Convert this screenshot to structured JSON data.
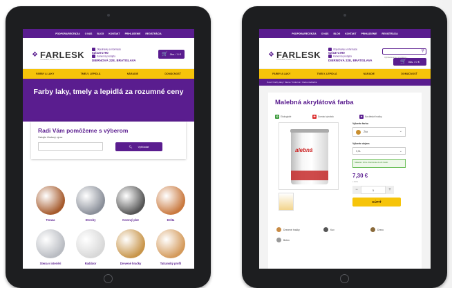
{
  "top_nav": [
    "PODPORA/RECENZIA",
    "O NÁS",
    "BLOG",
    "KONTAKT",
    "PRIHLÁSENIE",
    "REGISTRÁCIA"
  ],
  "logo": {
    "name": "FARLESK",
    "tagline": "STAVEBNÉ, FARBY, LAKY"
  },
  "contact": {
    "label": "Objednávky a informácie",
    "phone": "02/4371790",
    "address_label": "Kamenná predajňa",
    "address": "DIERNOVÁ 22E, BRATISLAVA"
  },
  "cart": {
    "label": "0ks. / 0 €"
  },
  "search": {
    "placeholder": "Vyhľadávanie produktov..."
  },
  "menu": [
    "FARBY A LAKY",
    "TMELY, LEPIDLÁ",
    "NÁRADIE",
    "DOMÁCNOSŤ"
  ],
  "hero_title": "Farby laky, tmely a lepidlá za rozumné ceny",
  "widget": {
    "title": "Radi Vám pomôžeme s výberom",
    "label": "Zadajte hľadaný výraz",
    "button": "Vyhľadať"
  },
  "categories": [
    {
      "name": "Terasa",
      "color": "#a55a2c"
    },
    {
      "name": "Strechy",
      "color": "#8a8f99"
    },
    {
      "name": "Kovový plot",
      "color": "#555555"
    },
    {
      "name": "Drôta",
      "color": "#c9793f"
    },
    {
      "name": "Stena v interiéri",
      "color": "#b9bcc2"
    },
    {
      "name": "Radiátor",
      "color": "#d8d8d8"
    },
    {
      "name": "Drevené hračky",
      "color": "#c8954a"
    },
    {
      "name": "Tatranský profil",
      "color": "#d49a5b"
    }
  ],
  "breadcrumb": "Úvod / Farby laky / Stena / Vnútorné / Vodou riediteľné",
  "product": {
    "title": "Malebná akrylátová farba",
    "features": [
      "Ekologické",
      "Domáci výrobok",
      "Na detské hračky"
    ],
    "brand_on_can": "alebná",
    "color_label": "Vyberte farbu",
    "color_value": "Žltá",
    "volume_label": "Vyberte objem",
    "volume_value": "0,5L",
    "stock": "Skladom 10 ks. Doručenie do 24 hodín.",
    "price": "7,30 €",
    "price_note": "s DPH",
    "qty": "1",
    "buy": "KÚPIŤ",
    "uses": [
      "Drevené hračky",
      "Kov",
      "Drevo",
      "Betón"
    ]
  }
}
